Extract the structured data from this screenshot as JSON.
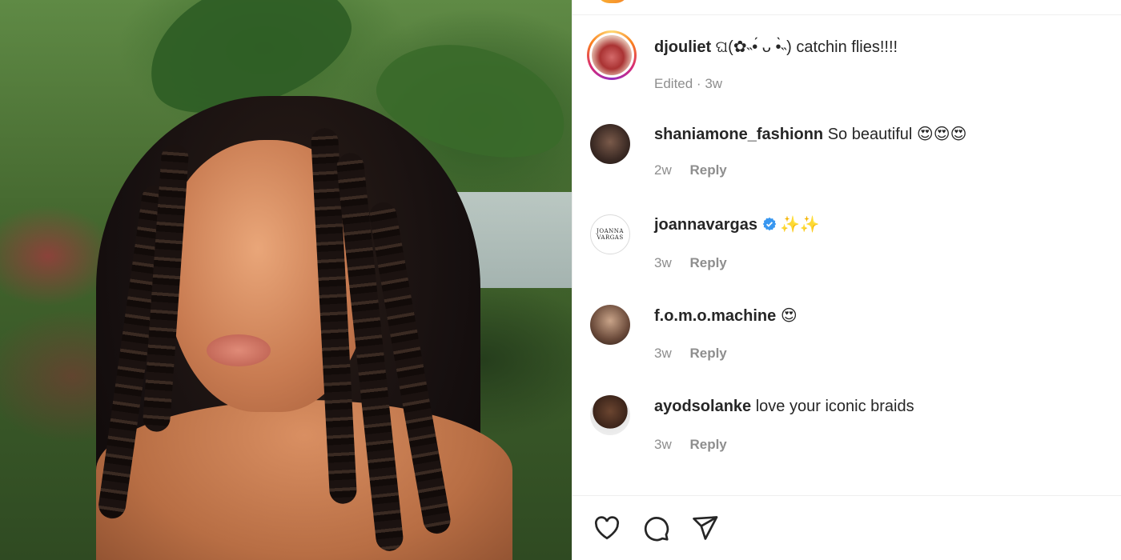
{
  "post": {
    "author": "djouliet",
    "caption": "ଘ(✿˵•́ ᴗ •̀˵) catchin flies!!!!",
    "edited_label": "Edited",
    "time": "3w"
  },
  "comments": [
    {
      "username": "shaniamone_fashionn",
      "text": "So beautiful 😍😍😍",
      "time": "2w",
      "reply_label": "Reply",
      "verified": false
    },
    {
      "username": "joannavargas",
      "text": "✨✨",
      "time": "3w",
      "reply_label": "Reply",
      "verified": true,
      "avatar_text": "JOANNA VARGAS"
    },
    {
      "username": "f.o.m.o.machine",
      "text": "😍",
      "time": "3w",
      "reply_label": "Reply",
      "verified": false
    },
    {
      "username": "ayodsolanke",
      "text": "love your iconic braids",
      "time": "3w",
      "reply_label": "Reply",
      "verified": false
    }
  ],
  "actions": [
    "heart-icon",
    "comment-icon",
    "share-icon"
  ],
  "colors": {
    "meta_gray": "#8e8e8e",
    "text": "#262626",
    "verified_blue": "#3897f0",
    "divider": "#efefef"
  }
}
